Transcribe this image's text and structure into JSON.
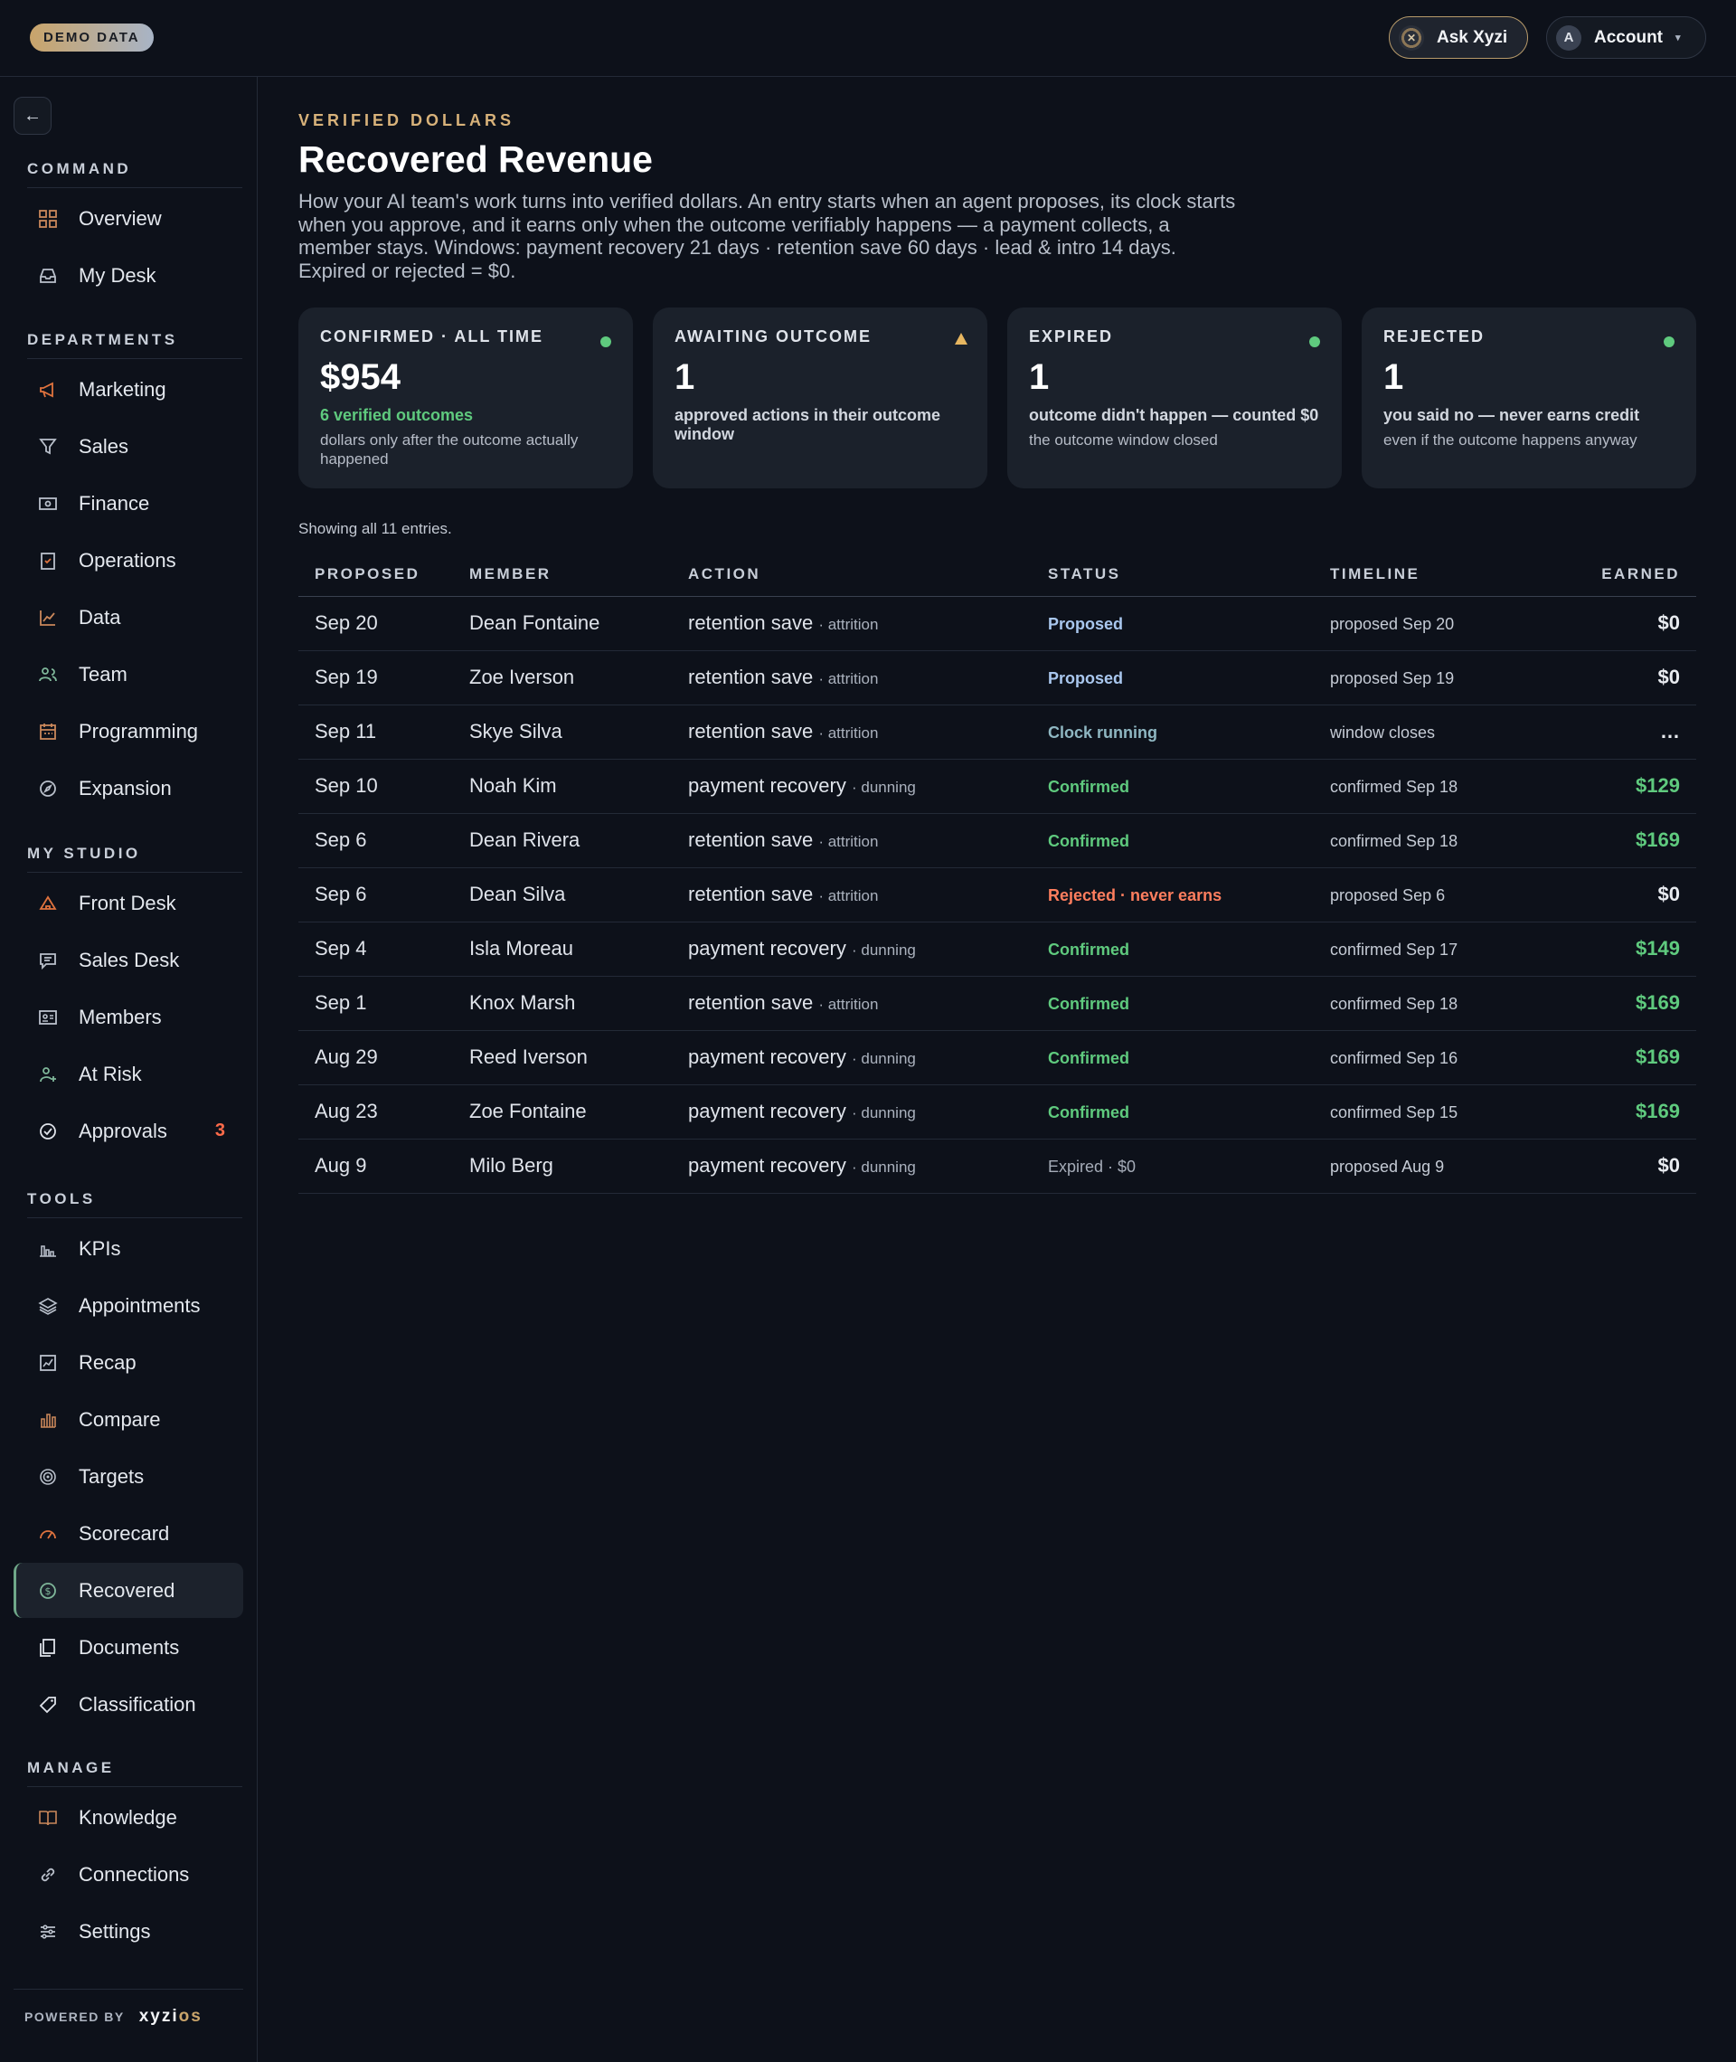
{
  "topbar": {
    "demo_badge": "DEMO DATA",
    "ask_label": "Ask Xyzi",
    "account_label": "Account",
    "account_initial": "A"
  },
  "sidebar": {
    "sections": [
      {
        "title": "COMMAND",
        "items": [
          {
            "label": "Overview",
            "icon": "grid-icon"
          },
          {
            "label": "My Desk",
            "icon": "inbox-icon"
          }
        ]
      },
      {
        "title": "DEPARTMENTS",
        "items": [
          {
            "label": "Marketing",
            "icon": "megaphone-icon"
          },
          {
            "label": "Sales",
            "icon": "funnel-icon"
          },
          {
            "label": "Finance",
            "icon": "banknote-icon"
          },
          {
            "label": "Operations",
            "icon": "clipboard-check-icon"
          },
          {
            "label": "Data",
            "icon": "line-chart-icon"
          },
          {
            "label": "Team",
            "icon": "users-icon"
          },
          {
            "label": "Programming",
            "icon": "calendar-icon"
          },
          {
            "label": "Expansion",
            "icon": "compass-icon"
          }
        ]
      },
      {
        "title": "MY STUDIO",
        "items": [
          {
            "label": "Front Desk",
            "icon": "bell-icon"
          },
          {
            "label": "Sales Desk",
            "icon": "message-icon"
          },
          {
            "label": "Members",
            "icon": "id-card-icon"
          },
          {
            "label": "At Risk",
            "icon": "user-alert-icon"
          },
          {
            "label": "Approvals",
            "icon": "check-circle-icon",
            "badge": "3"
          }
        ]
      },
      {
        "title": "TOOLS",
        "items": [
          {
            "label": "KPIs",
            "icon": "bar-chart-icon"
          },
          {
            "label": "Appointments",
            "icon": "layers-icon"
          },
          {
            "label": "Recap",
            "icon": "trend-doc-icon"
          },
          {
            "label": "Compare",
            "icon": "compare-bars-icon"
          },
          {
            "label": "Targets",
            "icon": "target-icon"
          },
          {
            "label": "Scorecard",
            "icon": "gauge-icon"
          },
          {
            "label": "Recovered",
            "icon": "dollar-cycle-icon",
            "active": true
          },
          {
            "label": "Documents",
            "icon": "documents-icon"
          },
          {
            "label": "Classification",
            "icon": "tag-icon"
          }
        ]
      },
      {
        "title": "MANAGE",
        "items": [
          {
            "label": "Knowledge",
            "icon": "book-icon"
          },
          {
            "label": "Connections",
            "icon": "link-icon"
          },
          {
            "label": "Settings",
            "icon": "sliders-icon"
          }
        ]
      }
    ],
    "powered_by": "POWERED BY",
    "logo_main": "xyzi",
    "logo_accent": "os"
  },
  "page": {
    "eyebrow": "VERIFIED DOLLARS",
    "title": "Recovered Revenue",
    "description": "How your AI team's work turns into verified dollars. An entry starts when an agent proposes, its clock starts when you approve, and it earns only when the outcome verifiably happens — a payment collects, a member stays. Windows: payment recovery 21 days · retention save 60 days · lead & intro 14 days. Expired or rejected = $0."
  },
  "cards": [
    {
      "title": "CONFIRMED · ALL TIME",
      "value": "$954",
      "line1": "6 verified outcomes",
      "line2": "dollars only after the outcome actually happened",
      "indicator": "dot",
      "indicator_color": "#5fca7e"
    },
    {
      "title": "AWAITING OUTCOME",
      "value": "1",
      "line1": "approved actions in their outcome window",
      "line2": "",
      "indicator": "triangle",
      "indicator_color": "#e7b660"
    },
    {
      "title": "EXPIRED",
      "value": "1",
      "line1": "outcome didn't happen — counted $0",
      "line2": "the outcome window closed",
      "indicator": "dot",
      "indicator_color": "#5fca7e"
    },
    {
      "title": "REJECTED",
      "value": "1",
      "line1": "you said no — never earns credit",
      "line2": "even if the outcome happens anyway",
      "indicator": "dot",
      "indicator_color": "#5fca7e"
    }
  ],
  "table": {
    "showing": "Showing all 11 entries.",
    "headers": [
      "PROPOSED",
      "MEMBER",
      "ACTION",
      "STATUS",
      "TIMELINE",
      "EARNED"
    ],
    "rows": [
      {
        "proposed": "Sep 20",
        "member": "Dean Fontaine",
        "action": "retention save",
        "kind": "· attrition",
        "status": "Proposed",
        "status_type": "proposed",
        "timeline": "proposed Sep 20",
        "earned": "$0",
        "positive": false
      },
      {
        "proposed": "Sep 19",
        "member": "Zoe Iverson",
        "action": "retention save",
        "kind": "· attrition",
        "status": "Proposed",
        "status_type": "proposed",
        "timeline": "proposed Sep 19",
        "earned": "$0",
        "positive": false
      },
      {
        "proposed": "Sep 11",
        "member": "Skye Silva",
        "action": "retention save",
        "kind": "· attrition",
        "status": "Clock running",
        "status_type": "running",
        "timeline": "window closes",
        "earned": "…",
        "positive": false
      },
      {
        "proposed": "Sep 10",
        "member": "Noah Kim",
        "action": "payment recovery",
        "kind": "· dunning",
        "status": "Confirmed",
        "status_type": "confirmed",
        "timeline": "confirmed Sep 18",
        "earned": "$129",
        "positive": true
      },
      {
        "proposed": "Sep 6",
        "member": "Dean Rivera",
        "action": "retention save",
        "kind": "· attrition",
        "status": "Confirmed",
        "status_type": "confirmed",
        "timeline": "confirmed Sep 18",
        "earned": "$169",
        "positive": true
      },
      {
        "proposed": "Sep 6",
        "member": "Dean Silva",
        "action": "retention save",
        "kind": "· attrition",
        "status": "Rejected · never earns",
        "status_type": "rejected",
        "timeline": "proposed Sep 6",
        "earned": "$0",
        "positive": false
      },
      {
        "proposed": "Sep 4",
        "member": "Isla Moreau",
        "action": "payment recovery",
        "kind": "· dunning",
        "status": "Confirmed",
        "status_type": "confirmed",
        "timeline": "confirmed Sep 17",
        "earned": "$149",
        "positive": true
      },
      {
        "proposed": "Sep 1",
        "member": "Knox Marsh",
        "action": "retention save",
        "kind": "· attrition",
        "status": "Confirmed",
        "status_type": "confirmed",
        "timeline": "confirmed Sep 18",
        "earned": "$169",
        "positive": true
      },
      {
        "proposed": "Aug 29",
        "member": "Reed Iverson",
        "action": "payment recovery",
        "kind": "· dunning",
        "status": "Confirmed",
        "status_type": "confirmed",
        "timeline": "confirmed Sep 16",
        "earned": "$169",
        "positive": true
      },
      {
        "proposed": "Aug 23",
        "member": "Zoe Fontaine",
        "action": "payment recovery",
        "kind": "· dunning",
        "status": "Confirmed",
        "status_type": "confirmed",
        "timeline": "confirmed Sep 15",
        "earned": "$169",
        "positive": true
      },
      {
        "proposed": "Aug 9",
        "member": "Milo Berg",
        "action": "payment recovery",
        "kind": "· dunning",
        "status": "Expired · $0",
        "status_type": "expired",
        "timeline": "proposed Aug 9",
        "earned": "$0",
        "positive": false
      }
    ]
  }
}
